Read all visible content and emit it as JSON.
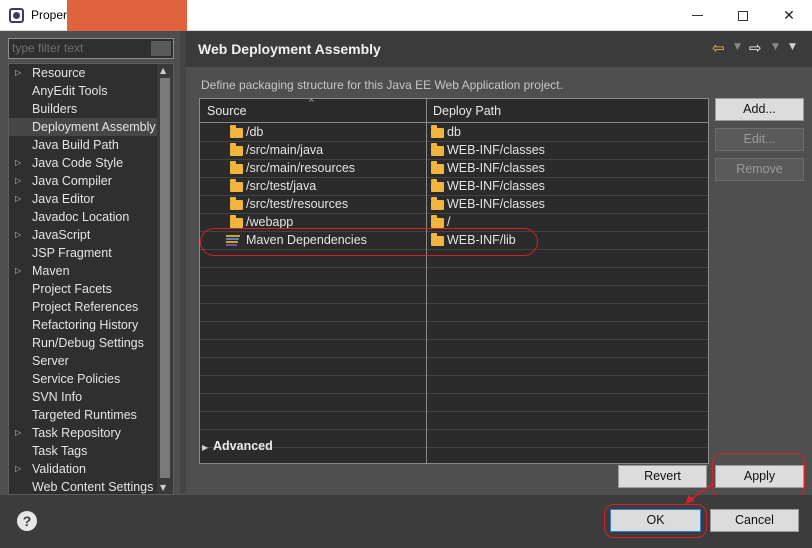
{
  "window": {
    "title": "Proper",
    "minimize_glyph": "",
    "close_glyph": "✕"
  },
  "nav": {
    "filter_placeholder": "type filter text",
    "items": [
      {
        "label": "Resource",
        "expandable": true
      },
      {
        "label": "AnyEdit Tools",
        "expandable": false
      },
      {
        "label": "Builders",
        "expandable": false
      },
      {
        "label": "Deployment Assembly",
        "expandable": false,
        "selected": true
      },
      {
        "label": "Java Build Path",
        "expandable": false
      },
      {
        "label": "Java Code Style",
        "expandable": true
      },
      {
        "label": "Java Compiler",
        "expandable": true
      },
      {
        "label": "Java Editor",
        "expandable": true
      },
      {
        "label": "Javadoc Location",
        "expandable": false
      },
      {
        "label": "JavaScript",
        "expandable": true
      },
      {
        "label": "JSP Fragment",
        "expandable": false
      },
      {
        "label": "Maven",
        "expandable": true
      },
      {
        "label": "Project Facets",
        "expandable": false
      },
      {
        "label": "Project References",
        "expandable": false
      },
      {
        "label": "Refactoring History",
        "expandable": false
      },
      {
        "label": "Run/Debug Settings",
        "expandable": false
      },
      {
        "label": "Server",
        "expandable": false
      },
      {
        "label": "Service Policies",
        "expandable": false
      },
      {
        "label": "SVN Info",
        "expandable": false
      },
      {
        "label": "Targeted Runtimes",
        "expandable": false
      },
      {
        "label": "Task Repository",
        "expandable": true
      },
      {
        "label": "Task Tags",
        "expandable": false
      },
      {
        "label": "Validation",
        "expandable": true
      },
      {
        "label": "Web Content Settings",
        "expandable": false
      }
    ]
  },
  "page": {
    "title": "Web Deployment Assembly",
    "description": "Define packaging structure for this Java EE Web Application project.",
    "columns": {
      "source": "Source",
      "deploy_path": "Deploy Path"
    },
    "rows": [
      {
        "source": "/db",
        "deploy": "db",
        "icon": "folder-icon"
      },
      {
        "source": "/src/main/java",
        "deploy": "WEB-INF/classes",
        "icon": "folder-icon"
      },
      {
        "source": "/src/main/resources",
        "deploy": "WEB-INF/classes",
        "icon": "folder-icon"
      },
      {
        "source": "/src/test/java",
        "deploy": "WEB-INF/classes",
        "icon": "folder-icon"
      },
      {
        "source": "/src/test/resources",
        "deploy": "WEB-INF/classes",
        "icon": "folder-icon"
      },
      {
        "source": "/webapp",
        "deploy": "/",
        "icon": "folder-icon"
      },
      {
        "source": "Maven Dependencies",
        "deploy": "WEB-INF/lib",
        "icon": "library-icon"
      }
    ],
    "buttons": {
      "add": "Add...",
      "edit": "Edit...",
      "remove": "Remove"
    },
    "advanced_label": "Advanced",
    "revert": "Revert",
    "apply": "Apply"
  },
  "footer": {
    "help": "?",
    "ok": "OK",
    "cancel": "Cancel"
  },
  "colors": {
    "annotation": "#d8202a",
    "folder": "#f0b53c",
    "back_arrow": "#f0c040"
  }
}
